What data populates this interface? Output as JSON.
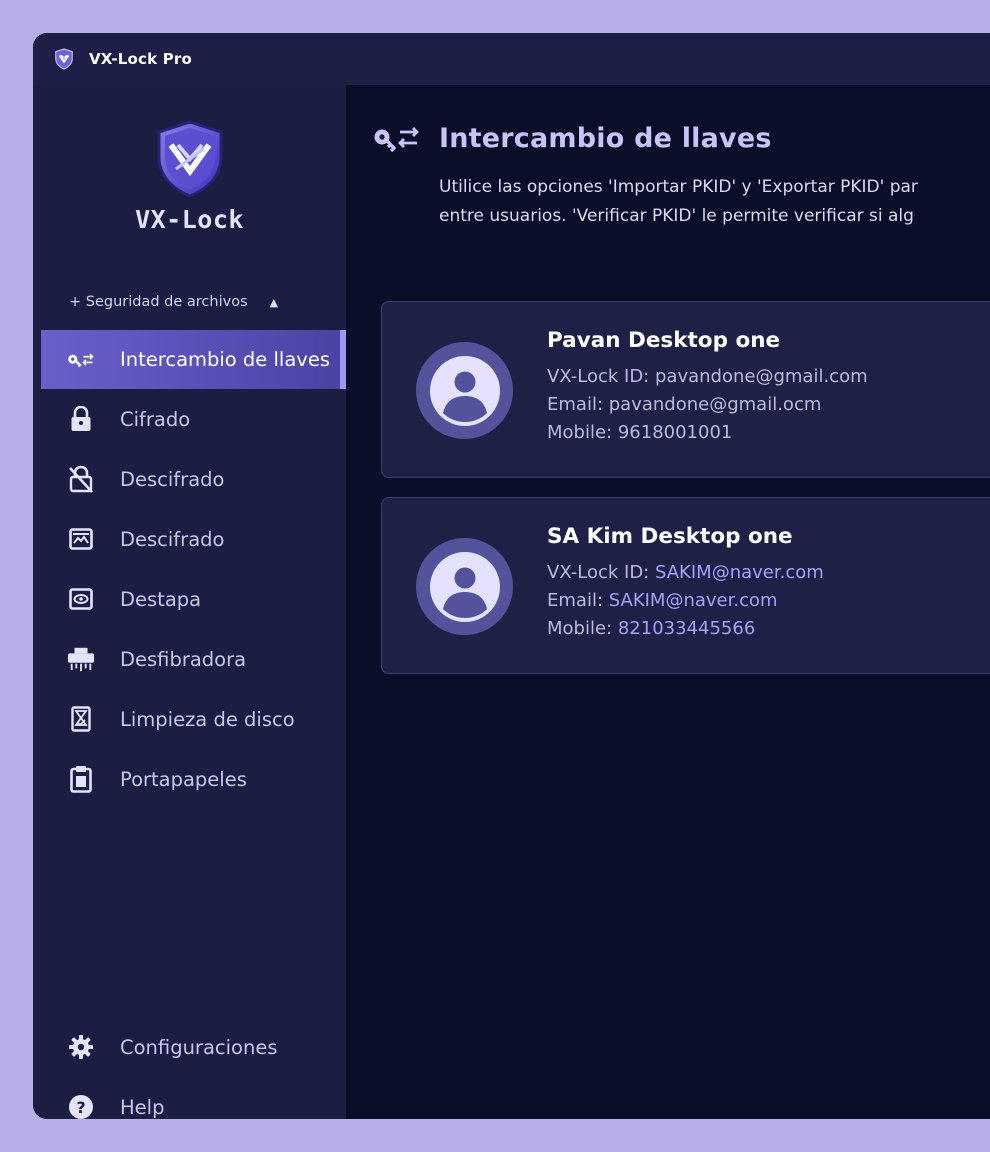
{
  "window": {
    "title": "VX-Lock Pro"
  },
  "brand": {
    "name": "VX-Lock"
  },
  "sidebar": {
    "section_label": "+ Seguridad de archivos",
    "items": [
      {
        "label": "Intercambio de llaves",
        "icon": "key-exchange-icon",
        "active": true
      },
      {
        "label": "Cifrado",
        "icon": "lock-icon"
      },
      {
        "label": "Descifrado",
        "icon": "unlock-slash-icon"
      },
      {
        "label": "Descifrado",
        "icon": "image-icon"
      },
      {
        "label": "Destapa",
        "icon": "eye-box-icon"
      },
      {
        "label": "Desfibradora",
        "icon": "shredder-icon"
      },
      {
        "label": "Limpieza de disco",
        "icon": "disk-clean-icon"
      },
      {
        "label": "Portapapeles",
        "icon": "clipboard-icon"
      }
    ],
    "bottom_items": [
      {
        "label": "Configuraciones",
        "icon": "gear-icon"
      },
      {
        "label": "Help",
        "icon": "help-icon"
      }
    ]
  },
  "main": {
    "title": "Intercambio de llaves",
    "description_line1": "Utilice las opciones 'Importar PKID' y 'Exportar PKID' par",
    "description_line2": "entre usuarios. 'Verificar PKID' le permite verificar si alg",
    "contacts": [
      {
        "name": "Pavan Desktop one",
        "id_label": "VX-Lock ID:",
        "id_value": "pavandone@gmail.com",
        "email_label": "Email:",
        "email_value": "pavandone@gmail.ocm",
        "mobile_label": "Mobile:",
        "mobile_value": "9618001001"
      },
      {
        "name": "SA Kim Desktop one",
        "id_label": "VX-Lock ID:",
        "id_value": "SAKIM@naver.com",
        "email_label": "Email:",
        "email_value": "SAKIM@naver.com",
        "mobile_label": "Mobile:",
        "mobile_value": "821033445566"
      }
    ]
  },
  "colors": {
    "accent": "#6a60cc",
    "sidebar_bg": "#1b1d43",
    "main_bg": "#0a0e28",
    "highlight_value": "#a4a1fb"
  }
}
